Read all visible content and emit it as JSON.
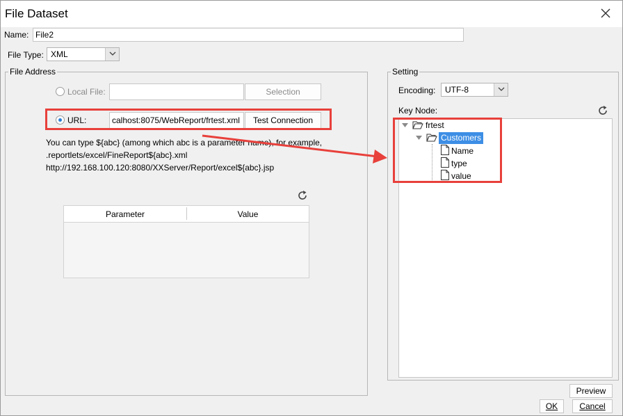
{
  "window": {
    "title": "File Dataset"
  },
  "form": {
    "name_label": "Name:",
    "name_value": "File2",
    "file_type_label": "File Type:",
    "file_type_value": "XML"
  },
  "file_address": {
    "legend": "File Address",
    "local_file_label": "Local File:",
    "local_file_value": "",
    "selection_button": "Selection",
    "url_label": "URL:",
    "url_value": "calhost:8075/WebReport/frtest.xml",
    "test_connection_button": "Test Connection",
    "hint_line1": "You can type ${abc} (among which abc is a parameter name), for example,",
    "hint_line2": ".reportlets/excel/FineReport${abc}.xml",
    "hint_line3": "http://192.168.100.120:8080/XXServer/Report/excel${abc}.jsp",
    "table": {
      "columns": [
        "Parameter",
        "Value"
      ],
      "rows": []
    }
  },
  "setting": {
    "legend": "Setting",
    "encoding_label": "Encoding:",
    "encoding_value": "UTF-8",
    "key_node_label": "Key Node:",
    "tree": {
      "root": "frtest",
      "child": "Customers",
      "leaves": [
        "Name",
        "type",
        "value"
      ]
    },
    "preview_button": "Preview"
  },
  "footer": {
    "ok_button": "OK",
    "cancel_button": "Cancel"
  },
  "colors": {
    "highlight_box": "#e8403b",
    "selected_node_bg": "#3d8ee5",
    "radio_dot": "#2c7fd6"
  },
  "icons": [
    "close-icon",
    "refresh-icon",
    "folder-open-icon",
    "file-icon",
    "chevron-down-icon",
    "radio-icon"
  ]
}
